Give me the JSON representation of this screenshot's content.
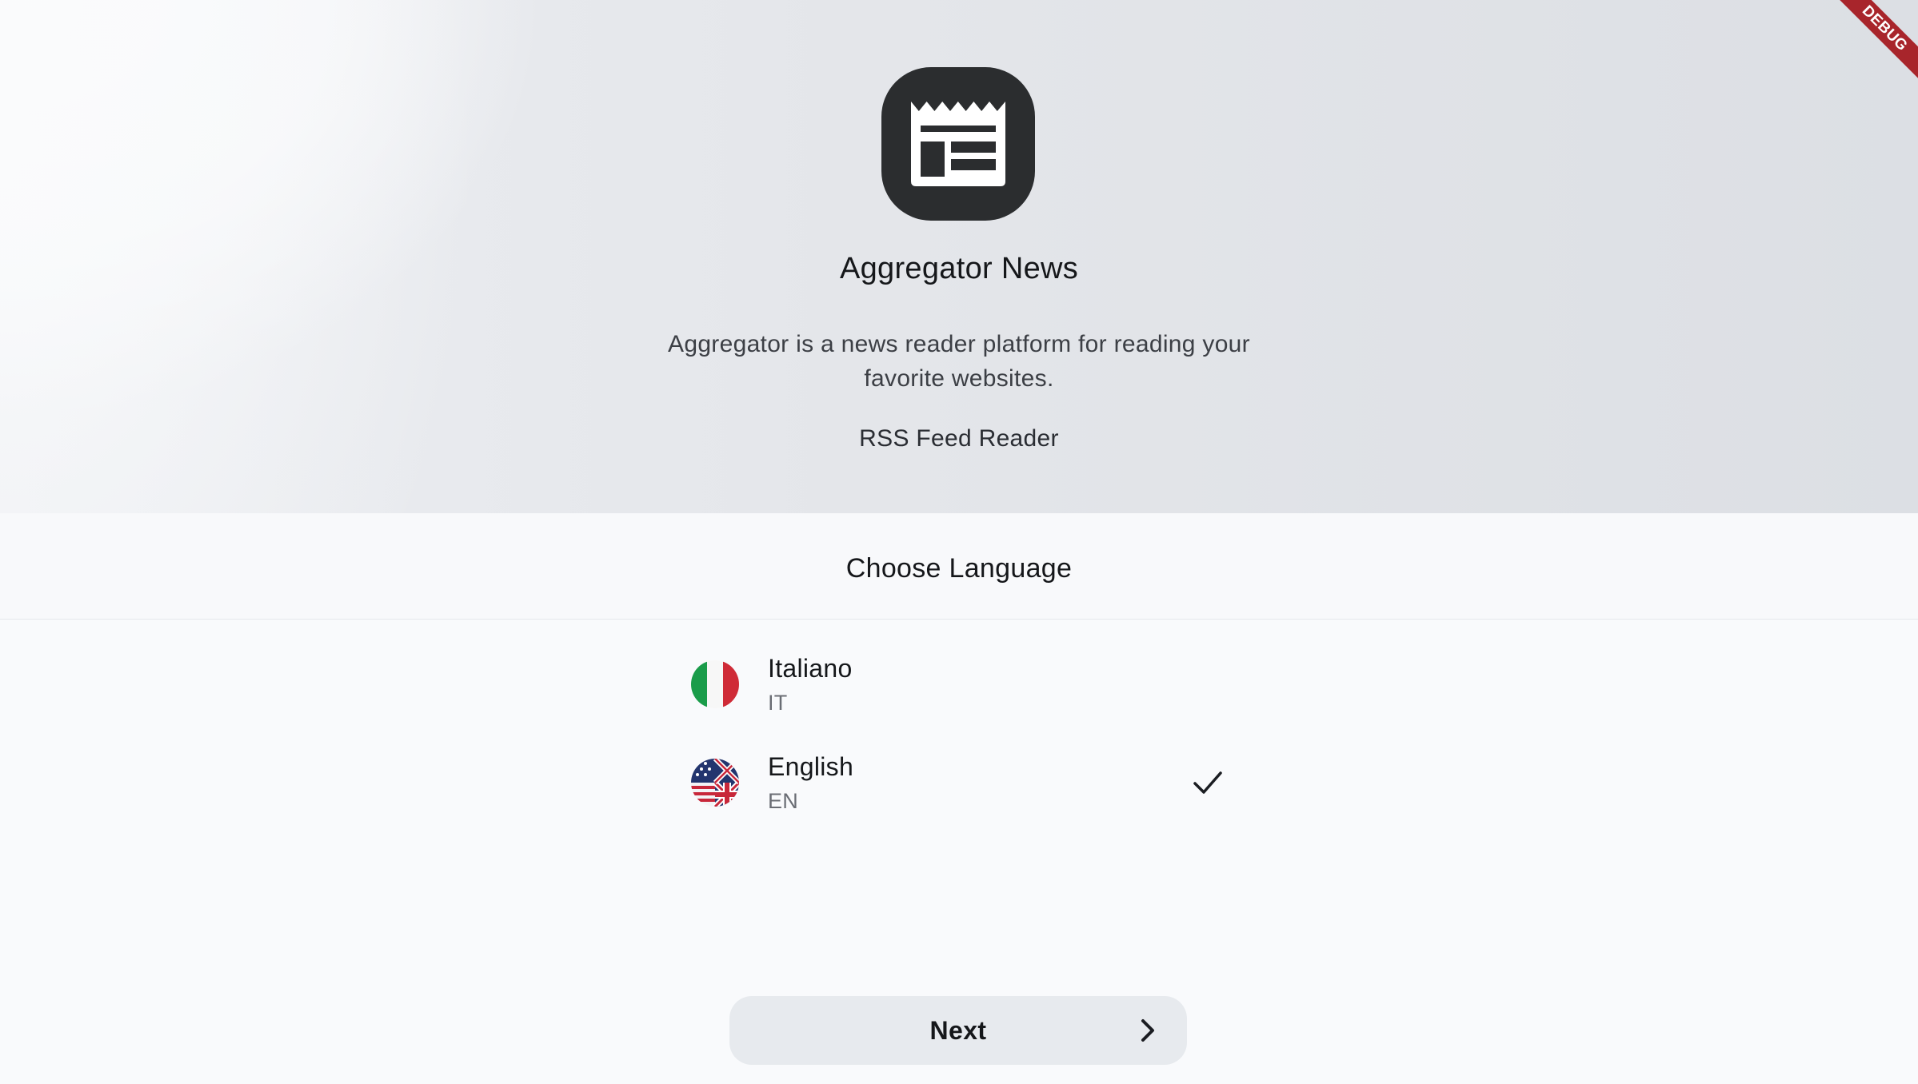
{
  "app": {
    "name": "Aggregator News",
    "description": "Aggregator is a news reader platform for reading your favorite websites.",
    "tagline": "RSS Feed Reader",
    "icon": "newspaper-icon"
  },
  "language_section": {
    "title": "Choose Language",
    "options": [
      {
        "name": "Italiano",
        "code": "IT",
        "flag": "italy-flag-icon",
        "selected": false
      },
      {
        "name": "English",
        "code": "EN",
        "flag": "uk-flag-icon",
        "selected": true
      }
    ],
    "selected_icon": "checkmark-icon"
  },
  "footer": {
    "next_label": "Next",
    "next_icon": "chevron-right-icon"
  },
  "debug_banner": {
    "label": "DEBUG"
  },
  "colors": {
    "icon_background": "#2b2d2f",
    "button_background": "#e7eaee",
    "debug_ribbon": "#a8252b",
    "italy_green": "#1a9c4a",
    "italy_red": "#cf2b37"
  }
}
